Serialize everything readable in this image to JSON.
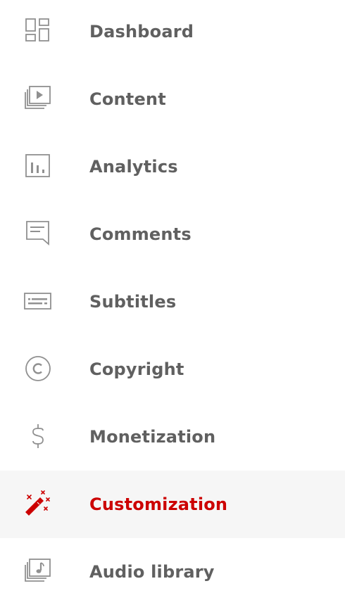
{
  "sidebar": {
    "active_index": 7,
    "colors": {
      "text": "#606060",
      "icon": "#909090",
      "active_text": "#cc0000",
      "active_background": "#f6f6f6"
    },
    "items": [
      {
        "label": "Dashboard",
        "icon": "dashboard-icon"
      },
      {
        "label": "Content",
        "icon": "content-icon"
      },
      {
        "label": "Analytics",
        "icon": "analytics-icon"
      },
      {
        "label": "Comments",
        "icon": "comments-icon"
      },
      {
        "label": "Subtitles",
        "icon": "subtitles-icon"
      },
      {
        "label": "Copyright",
        "icon": "copyright-icon"
      },
      {
        "label": "Monetization",
        "icon": "monetization-icon"
      },
      {
        "label": "Customization",
        "icon": "customization-icon"
      },
      {
        "label": "Audio library",
        "icon": "audio-library-icon"
      }
    ]
  }
}
